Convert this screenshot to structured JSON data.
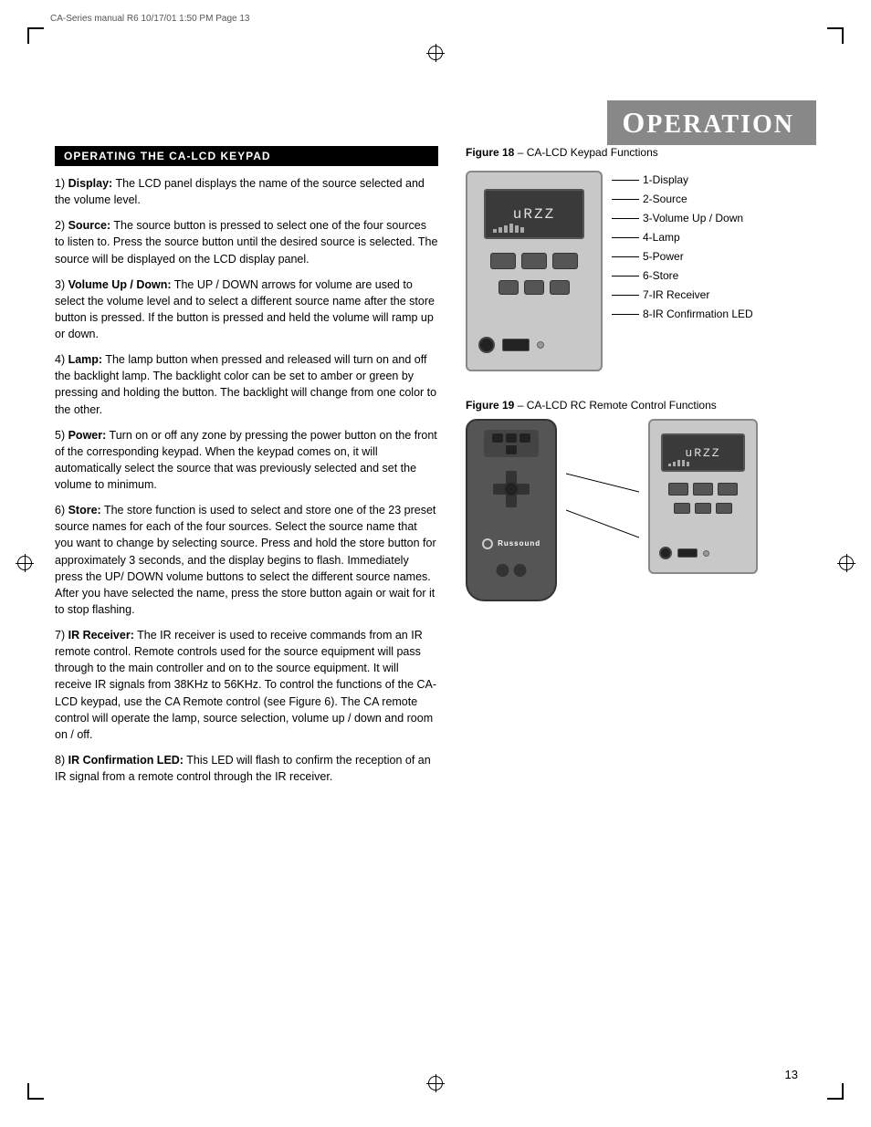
{
  "meta": {
    "header_text": "CA-Series manual R6   10/17/01   1:50 PM   Page 13"
  },
  "page_title": {
    "prefix": "O",
    "rest": "PERATION"
  },
  "section": {
    "header": "OPERATING THE CA-LCD KEYPAD",
    "items": [
      {
        "num": "1)",
        "label": "Display:",
        "text": " The LCD panel displays the name of the source selected and the volume level."
      },
      {
        "num": "2)",
        "label": "Source:",
        "text": " The source button is pressed to select one of the four sources to listen to. Press the source button until the desired source is selected. The source will be displayed on the LCD display panel."
      },
      {
        "num": "3)",
        "label": "Volume Up / Down:",
        "text": " The UP / DOWN arrows for volume are used to select the volume level and to select a different source name after the store button is pressed. If the button is pressed and held the volume will ramp up or down."
      },
      {
        "num": "4)",
        "label": "Lamp:",
        "text": " The lamp button when pressed and released will turn on and off the backlight lamp. The backlight color can be set to amber or green by pressing and holding the button. The backlight will change from one color to the other."
      },
      {
        "num": "5)",
        "label": "Power:",
        "text": " Turn on or off any zone by pressing the power button on the front of the corresponding keypad.  When the keypad comes on, it will automatically select the source that was previously selected and set the volume to minimum."
      },
      {
        "num": "6)",
        "label": "Store:",
        "text": " The store function is used to select and store one of the 23 preset source names for each of the four sources. Select the source name that you want to change by selecting source. Press and hold the store button for approximately 3 seconds, and the display begins to flash. Immediately press the UP/ DOWN volume buttons to select the different source names. After you have selected the name, press the store button again or wait for it to stop flashing."
      },
      {
        "num": "7)",
        "label": "IR Receiver:",
        "text": " The IR receiver is used to receive commands from an IR remote control. Remote controls used for the source equipment will pass through to the main controller and on to the source equipment. It will receive IR signals from 38KHz to 56KHz. To control the functions of the CA-LCD keypad, use the CA Remote control (see Figure 6). The CA remote control will operate the lamp, source selection, volume up / down and room on / off."
      },
      {
        "num": "8)",
        "label": "IR Confirmation LED:",
        "text": " This LED will flash to confirm the reception of an IR signal from a remote control through the IR receiver."
      }
    ]
  },
  "figure18": {
    "label": "Figure 18",
    "dash": " – ",
    "title": "CA-LCD Keypad Functions",
    "display_text": "uRZZ",
    "callouts": [
      {
        "id": 1,
        "label": "1-Display"
      },
      {
        "id": 2,
        "label": "2-Source"
      },
      {
        "id": 3,
        "label": "3-Volume Up / Down"
      },
      {
        "id": 4,
        "label": "4-Lamp"
      },
      {
        "id": 5,
        "label": "5-Power"
      },
      {
        "id": 6,
        "label": "6-Store"
      },
      {
        "id": 7,
        "label": "7-IR Receiver"
      },
      {
        "id": 8,
        "label": "8-IR Confirmation LED"
      }
    ]
  },
  "figure19": {
    "label": "Figure 19",
    "dash": " – ",
    "title": "CA-LCD RC Remote Control Functions",
    "display_text": "uRZZ",
    "brand_text": "Russound"
  },
  "page_number": "13"
}
